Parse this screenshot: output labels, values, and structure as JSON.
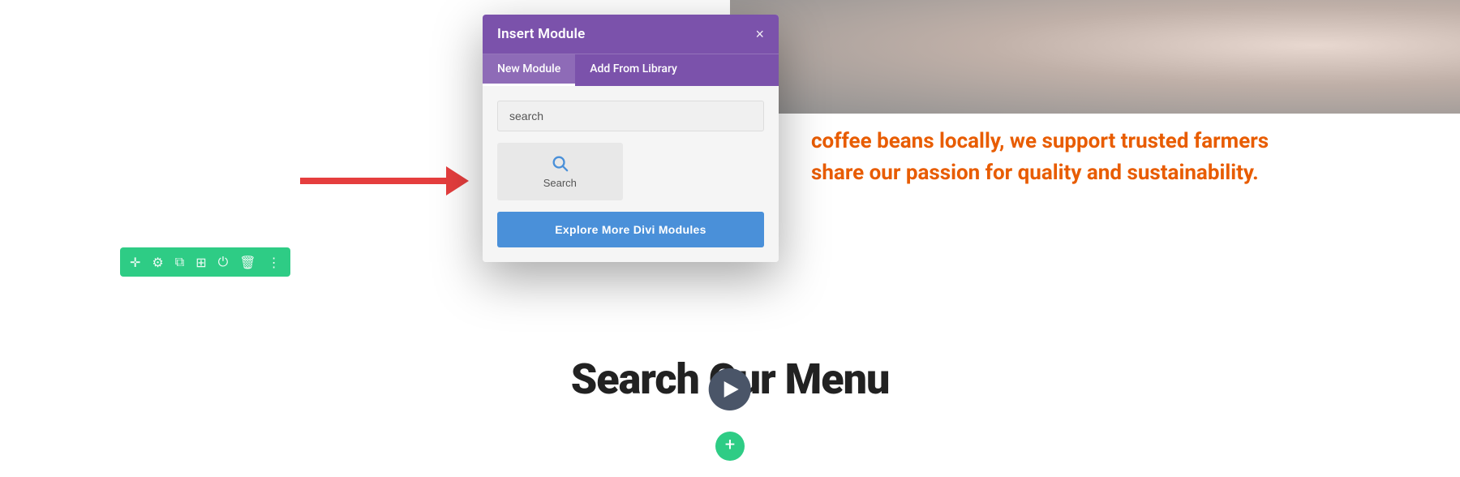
{
  "dialog": {
    "title": "Insert Module",
    "close_label": "×",
    "tabs": [
      {
        "label": "New Module",
        "active": true
      },
      {
        "label": "Add From Library",
        "active": false
      }
    ],
    "search_placeholder": "search",
    "search_button_label": "Search",
    "explore_button_label": "Explore More Divi Modules"
  },
  "page_content": {
    "orange_text_line1": "coffee beans locally, we support trusted farmers",
    "orange_text_line2": "share our passion for quality and sustainability.",
    "heading": "Search Our Menu"
  },
  "toolbar": {
    "icons": [
      "plus",
      "gear",
      "clone",
      "grid",
      "power",
      "trash",
      "dots"
    ]
  },
  "arrow": {
    "color": "#e53e3e"
  },
  "bottom_add": {
    "label": "+"
  }
}
